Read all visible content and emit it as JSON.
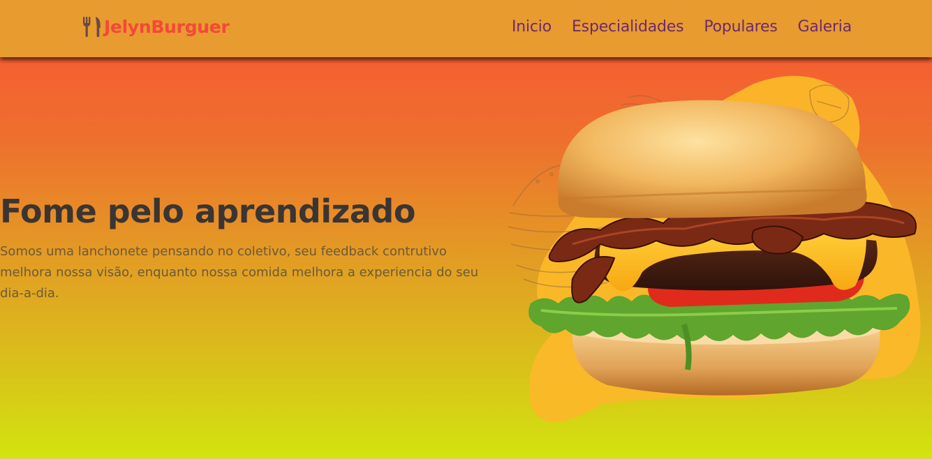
{
  "brand": {
    "icon": "utensils-icon",
    "name": "JelynBurguer",
    "color": "#f4483b"
  },
  "nav": {
    "items": [
      {
        "label": "Inicio"
      },
      {
        "label": "Especialidades"
      },
      {
        "label": "Populares"
      },
      {
        "label": "Galeria"
      }
    ],
    "color": "#6b2a6e",
    "background": "#e89b2f"
  },
  "hero": {
    "title": "Fome pelo aprendizado",
    "description": "Somos uma lanchonete pensando no coletivo, seu feedback contrutivo melhora nossa visão, enquanto nossa comida melhora a experiencia do seu dia-a-dia.",
    "image": "burger-illustration",
    "gradient_top": "#fa5433",
    "gradient_bottom": "#d2e40f"
  }
}
